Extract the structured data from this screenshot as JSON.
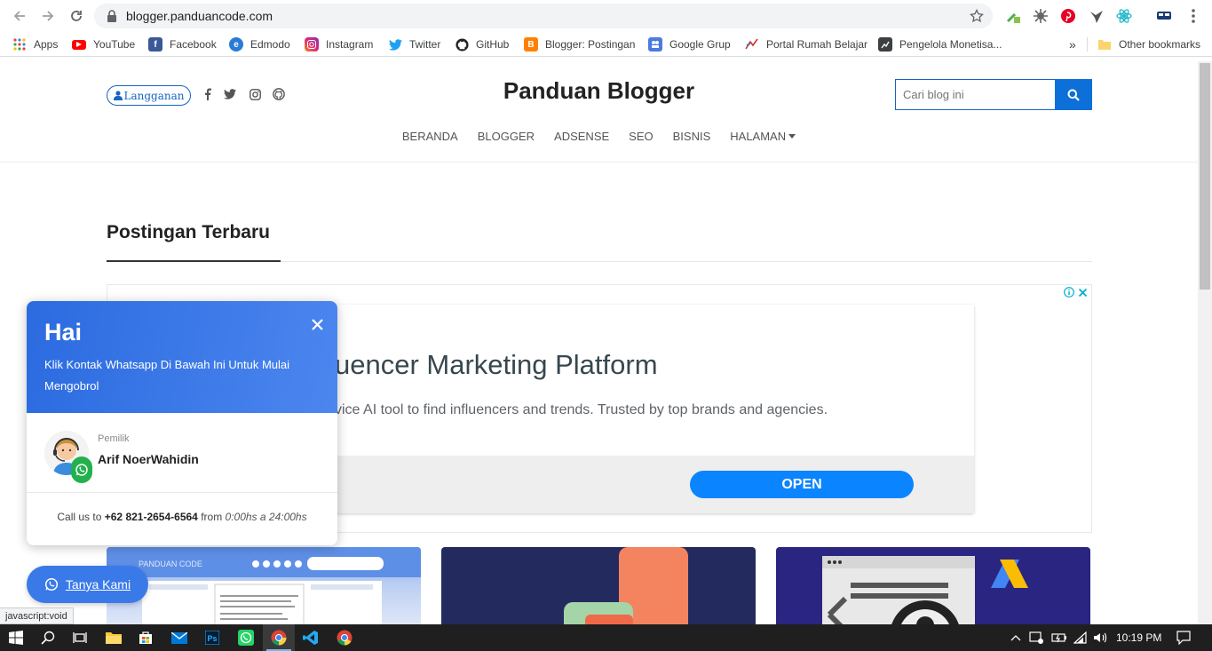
{
  "browser": {
    "url": "blogger.panduancode.com",
    "bookmarks": [
      {
        "label": "Apps",
        "icon": "apps-grid-icon"
      },
      {
        "label": "YouTube",
        "icon": "youtube-icon"
      },
      {
        "label": "Facebook",
        "icon": "facebook-icon"
      },
      {
        "label": "Edmodo",
        "icon": "edmodo-icon"
      },
      {
        "label": "Instagram",
        "icon": "instagram-icon"
      },
      {
        "label": "Twitter",
        "icon": "twitter-icon"
      },
      {
        "label": "GitHub",
        "icon": "github-icon"
      },
      {
        "label": "Blogger: Postingan",
        "icon": "blogger-icon"
      },
      {
        "label": "Google Grup",
        "icon": "google-groups-icon"
      },
      {
        "label": "Portal Rumah Belajar",
        "icon": "rumah-belajar-icon"
      },
      {
        "label": "Pengelola Monetisa...",
        "icon": "monetization-icon"
      }
    ],
    "more_bookmarks": "»",
    "other_bookmarks": "Other bookmarks",
    "status_tip": "javascript:void"
  },
  "site": {
    "subscribe_label": "Langganan",
    "brand": "Panduan Blogger",
    "search_placeholder": "Cari blog ini",
    "menu": [
      "BERANDA",
      "BLOGGER",
      "ADSENSE",
      "SEO",
      "BISNIS",
      "HALAMAN"
    ],
    "section_title": "Postingan Terbaru"
  },
  "ad": {
    "title": "uencer Marketing Platform",
    "description": "vice AI tool to find influencers and trends. Trusted by top brands and agencies.",
    "cta": "OPEN"
  },
  "thumbnail_texts": {
    "first_logo": "PANDUAN CODE"
  },
  "whatsapp": {
    "greeting": "Hai",
    "subtitle": "Klik Kontak Whatsapp Di Bawah Ini Untuk Mulai Mengobrol",
    "role": "Pemilik",
    "name": "Arif NoerWahidin",
    "call_prefix": "Call us to",
    "phone": "+62 821-2654-6564",
    "call_from": "from",
    "hours": "0:00hs a 24:00hs",
    "button_label": "Tanya Kami"
  },
  "taskbar": {
    "time": "10:19 PM"
  },
  "colors": {
    "accent": "#1565c0",
    "whatsapp_green": "#22b14c",
    "popup_blue": "#2b6be0",
    "ad_button": "#0a84ff"
  }
}
